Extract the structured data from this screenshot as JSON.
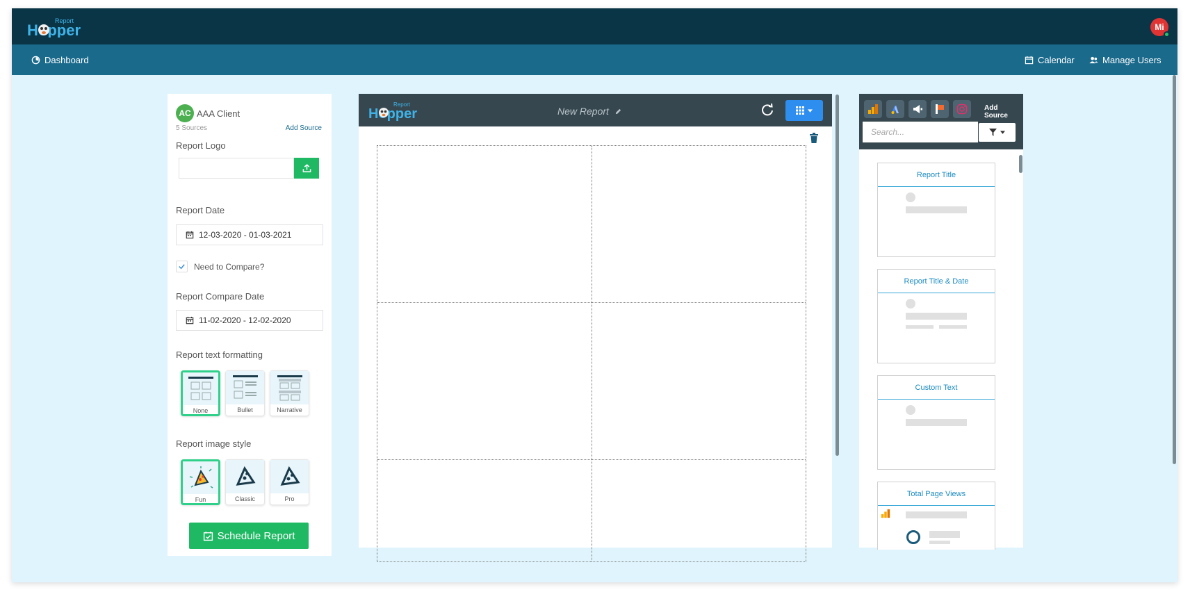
{
  "app": {
    "brand_top": "Report",
    "brand_main": "Hopper",
    "user_initials": "Mi"
  },
  "nav": {
    "dashboard": "Dashboard",
    "calendar": "Calendar",
    "manage_users": "Manage Users"
  },
  "client": {
    "initials": "AC",
    "name": "AAA Client",
    "sources": "5 Sources",
    "add_source": "Add Source"
  },
  "form": {
    "report_logo_label": "Report Logo",
    "report_date_label": "Report Date",
    "report_date_value": "12-03-2020 - 01-03-2021",
    "compare_label": "Need to Compare?",
    "compare_checked": true,
    "compare_date_label": "Report Compare Date",
    "compare_date_value": "11-02-2020 - 12-02-2020",
    "text_formatting_label": "Report text formatting",
    "text_formatting_options": [
      "None",
      "Bullet",
      "Narrative"
    ],
    "text_formatting_selected": "None",
    "image_style_label": "Report image style",
    "image_style_options": [
      "Fun",
      "Classic",
      "Pro"
    ],
    "image_style_selected": "Fun",
    "schedule_button": "Schedule Report"
  },
  "editor": {
    "report_title": "New Report"
  },
  "sidebar": {
    "add_source": "Add Source",
    "search_placeholder": "Search...",
    "source_icons": [
      "google-analytics-icon",
      "google-ads-icon",
      "facebook-ads-icon",
      "google-my-business-icon",
      "instagram-icon"
    ],
    "widgets": [
      "Report Title",
      "Report Title & Date",
      "Custom Text",
      "Total Page Views"
    ]
  },
  "colors": {
    "topbar": "#0a3547",
    "navbar": "#1a6a8c",
    "accent_green": "#1fb964",
    "accent_blue": "#2d8ef0",
    "panel_dark": "#37474f",
    "background": "#dff4fc"
  }
}
